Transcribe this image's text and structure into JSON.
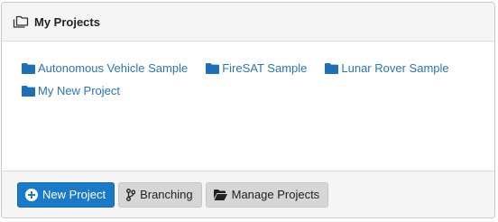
{
  "panel": {
    "title": "My Projects",
    "title_icon": "folders-icon"
  },
  "projects": [
    {
      "label": "Autonomous Vehicle Sample",
      "icon": "folder-icon"
    },
    {
      "label": "FireSAT Sample",
      "icon": "folder-icon"
    },
    {
      "label": "Lunar Rover Sample",
      "icon": "folder-icon"
    },
    {
      "label": "My New Project",
      "icon": "folder-icon"
    }
  ],
  "footer": {
    "new_project_label": "New Project",
    "new_project_icon": "plus-circle-icon",
    "branching_label": "Branching",
    "branching_icon": "branch-icon",
    "manage_projects_label": "Manage Projects",
    "manage_projects_icon": "folder-open-icon"
  },
  "colors": {
    "link": "#2a75b5",
    "primary": "#1a7ac9",
    "header_bg": "#f5f5f5",
    "button_default": "#d6d6d6"
  }
}
